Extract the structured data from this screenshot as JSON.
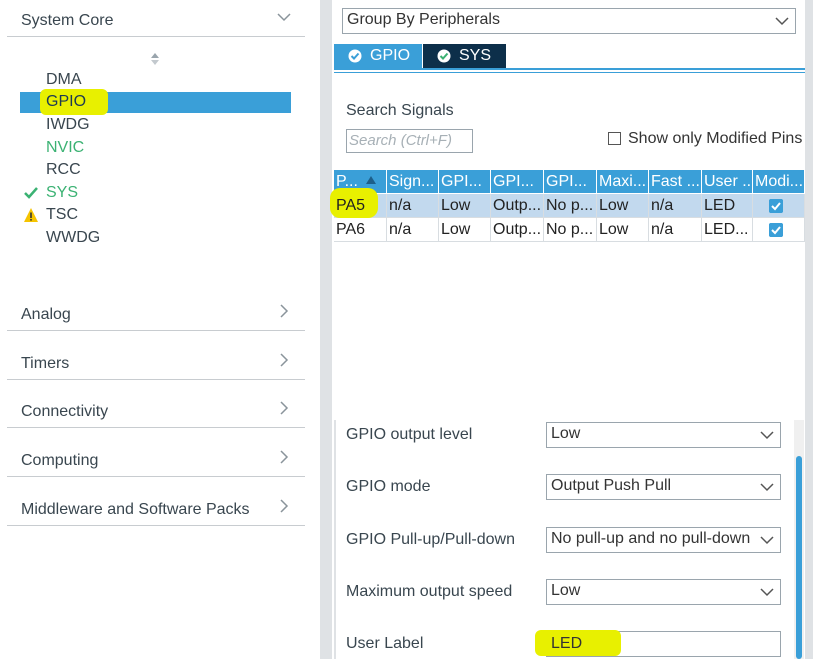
{
  "left_panel": {
    "system_core": {
      "label": "System Core",
      "items": [
        {
          "label": "DMA",
          "status": "none"
        },
        {
          "label": "GPIO",
          "status": "selected"
        },
        {
          "label": "IWDG",
          "status": "none"
        },
        {
          "label": "NVIC",
          "status": "enabled"
        },
        {
          "label": "RCC",
          "status": "none"
        },
        {
          "label": "SYS",
          "status": "ok"
        },
        {
          "label": "TSC",
          "status": "warning"
        },
        {
          "label": "WWDG",
          "status": "none"
        }
      ]
    },
    "categories": [
      "Analog",
      "Timers",
      "Connectivity",
      "Computing",
      "Middleware and Software Packs"
    ]
  },
  "right_panel": {
    "group_by": "Group By Peripherals",
    "tabs": [
      "GPIO",
      "SYS"
    ],
    "search": {
      "title": "Search Signals",
      "placeholder": "Search (Ctrl+F)"
    },
    "show_modified": {
      "label": "Show only Modified Pins",
      "checked": false
    },
    "table": {
      "headers": [
        "P...",
        "Sign...",
        "GPI...",
        "GPI...",
        "GPI...",
        "Maxi...",
        "Fast ...",
        "User ...",
        "Modi..."
      ],
      "rows": [
        [
          "PA5",
          "n/a",
          "Low",
          "Outp...",
          "No p...",
          "Low",
          "n/a",
          "LED",
          true
        ],
        [
          "PA6",
          "n/a",
          "Low",
          "Outp...",
          "No p...",
          "Low",
          "n/a",
          "LED...",
          true
        ]
      ],
      "selected_row": 0
    },
    "properties": [
      {
        "label": "GPIO output level",
        "value": "Low"
      },
      {
        "label": "GPIO mode",
        "value": "Output Push Pull"
      },
      {
        "label": "GPIO Pull-up/Pull-down",
        "value": "No pull-up and no pull-down"
      },
      {
        "label": "Maximum output speed",
        "value": "Low"
      }
    ],
    "user_label": {
      "label": "User Label",
      "value": "LED"
    }
  },
  "colors": {
    "accent": "#3a9fd8",
    "highlight": "#e8f000",
    "ok": "#3bb273",
    "warning": "#f5c400",
    "dark_tab": "#0d2f4a"
  }
}
